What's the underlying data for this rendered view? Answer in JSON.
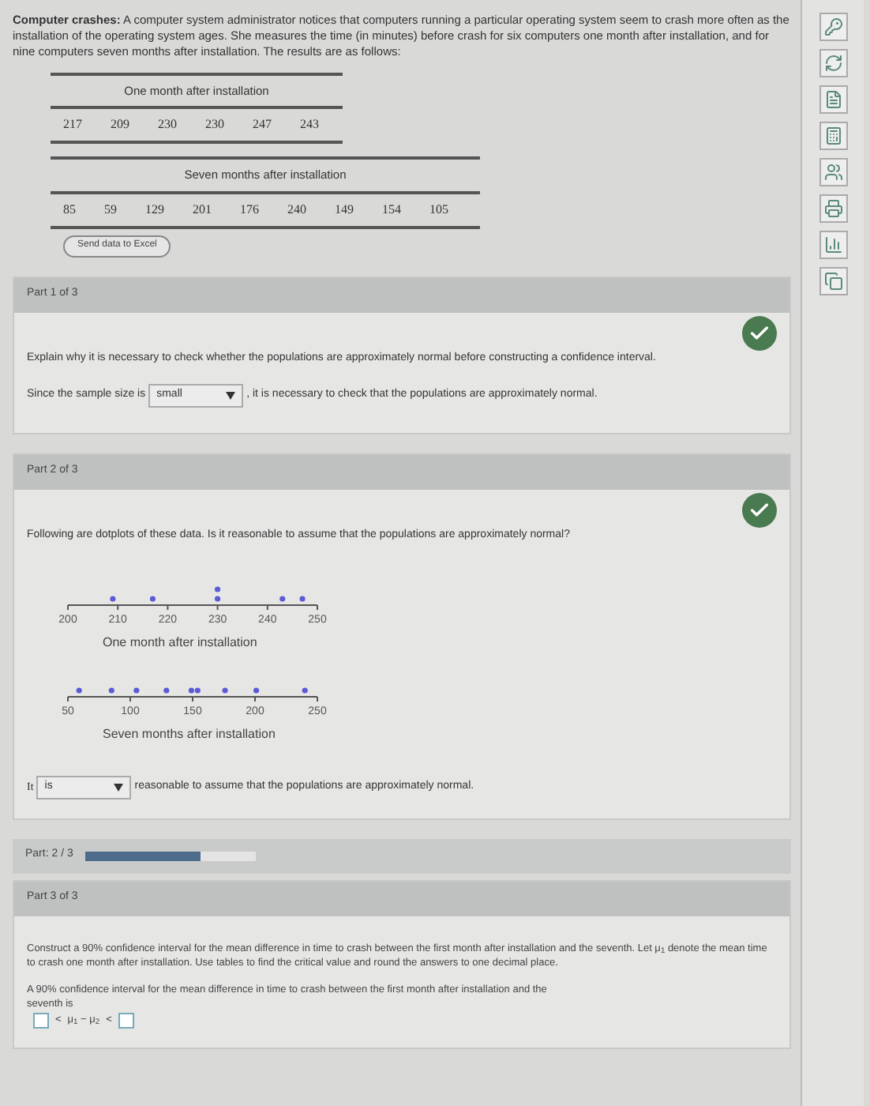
{
  "problem": {
    "title": "Computer crashes:",
    "text": "A computer system administrator notices that computers running a particular operating system seem to crash more often as the installation of the operating system ages. She measures the time (in minutes) before crash for six computers one month after installation, and for nine computers seven months after installation. The results are as follows:"
  },
  "tables": [
    {
      "caption": "One month after installation",
      "values": [
        "217",
        "209",
        "230",
        "230",
        "247",
        "243"
      ]
    },
    {
      "caption": "Seven months after installation",
      "values": [
        "85",
        "59",
        "129",
        "201",
        "176",
        "240",
        "149",
        "154",
        "105"
      ]
    }
  ],
  "excel_button": "Send data to Excel",
  "part1": {
    "header": "Part 1 of 3",
    "complete": true,
    "question": "Explain why it is necessary to check whether the populations are approximately normal before constructing a confidence interval.",
    "before": "Since the sample size is",
    "value": "small",
    "after": ", it is necessary to check that the populations are approximately normal."
  },
  "part2": {
    "header": "Part 2 of 3",
    "complete": true,
    "question": "Following are dotplots of these data. Is it reasonable to assume that the populations are approximately normal?",
    "plots": [
      {
        "caption": "One month after installation",
        "ticks": [
          "200",
          "210",
          "220",
          "230",
          "240",
          "250"
        ]
      },
      {
        "caption": "Seven months after installation",
        "ticks": [
          "50",
          "100",
          "150",
          "200",
          "250"
        ]
      }
    ],
    "before": "It",
    "value": "is",
    "after": "reasonable to assume that the populations are approximately normal."
  },
  "progress": {
    "label": "Part: 2 / 3",
    "level": 0.67
  },
  "part3": {
    "header": "Part 3 of 3",
    "question": "Construct a 90% confidence interval for the mean difference in time to crash between the first month after installation and the seventh. Let μ$_{1}$ denote the mean time to crash one month after installation. Use tables to find the critical value and round the answers to one decimal place.",
    "answer_text": "A 90% confidence interval for the mean difference in time to crash between the first month after installation and the seventh is",
    "relation_left": "<",
    "difference": "μ$_{1}$ − μ$_{2}$",
    "relation_right": "<"
  }
}
